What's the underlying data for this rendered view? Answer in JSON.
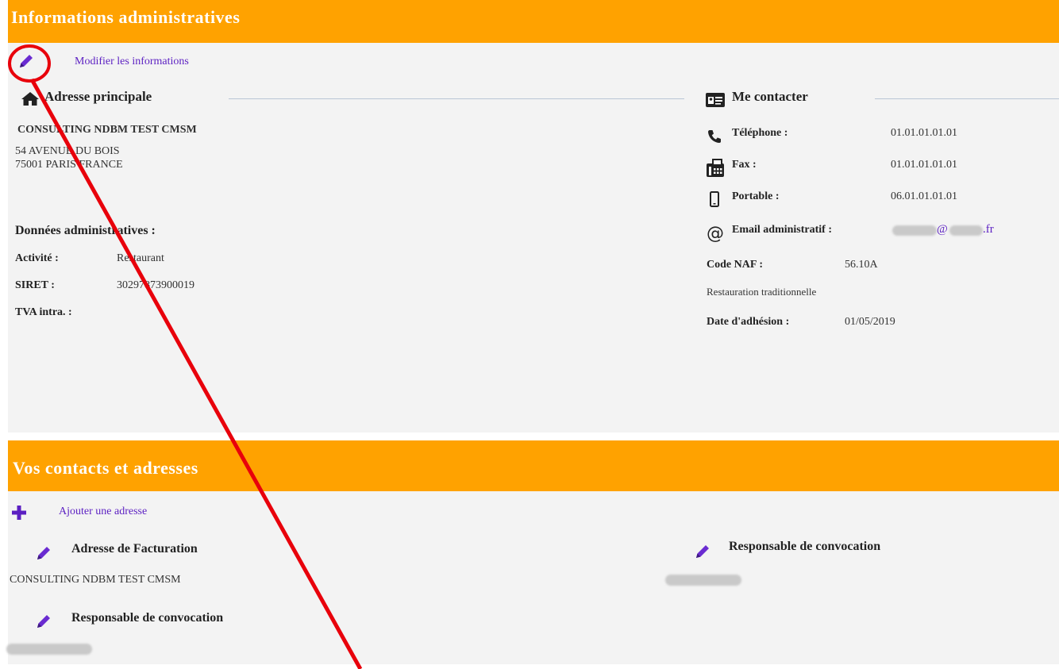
{
  "admin_section": {
    "title": "Informations administratives",
    "edit_link": "Modifier les informations",
    "address": {
      "title": "Adresse principale",
      "company": "CONSULTING NDBM TEST CMSM",
      "street": "54 AVENUE DU BOIS",
      "city": "75001 PARIS FRANCE"
    },
    "admin_data": {
      "title": "Données administratives :",
      "activity_label": "Activité :",
      "activity_value": "Restaurant",
      "siret_label": "SIRET :",
      "siret_value": "30297873900019",
      "tva_label": "TVA intra. :"
    },
    "contact": {
      "title": "Me contacter",
      "phone_label": "Téléphone :",
      "phone_value": "01.01.01.01.01",
      "fax_label": "Fax :",
      "fax_value": "01.01.01.01.01",
      "mobile_label": "Portable :",
      "mobile_value": "06.01.01.01.01",
      "email_label": "Email administratif :",
      "email_at": "@",
      "email_suffix": ".fr",
      "naf_label": "Code NAF :",
      "naf_value": "56.10A",
      "naf_desc": "Restauration traditionnelle",
      "join_label": "Date d'adhésion :",
      "join_value": "01/05/2019"
    }
  },
  "contacts_section": {
    "title": "Vos contacts et adresses",
    "add_link": "Ajouter une adresse",
    "billing_title": "Adresse de Facturation",
    "billing_value": "CONSULTING NDBM TEST CMSM",
    "responsible_title_1": "Responsable de convocation",
    "responsible_title_2": "Responsable de convocation"
  },
  "colors": {
    "header_orange": "#ffa200",
    "link_purple": "#5b1fc2",
    "annotation_red": "#e8000b"
  },
  "icons": [
    "pencil-icon",
    "home-icon",
    "contact-card-icon",
    "phone-icon",
    "fax-icon",
    "mobile-icon",
    "at-icon",
    "plus-icon"
  ]
}
